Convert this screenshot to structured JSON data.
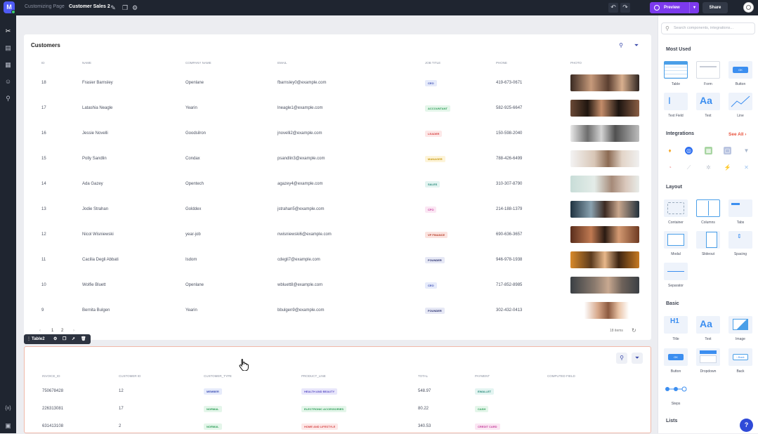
{
  "topbar": {
    "logo": "M",
    "breadcrumb_app": "Customizing Page",
    "page_name": "Customer Sales 2",
    "preview_label": "Preview",
    "share_label": "Share"
  },
  "table1": {
    "title": "Customers",
    "columns": [
      "ID",
      "NAME",
      "COMPANY NAME",
      "EMAIL",
      "JOB TITLE",
      "PHONE",
      "PHOTO"
    ],
    "rows": [
      {
        "id": "18",
        "name": "Frasier Barnsley",
        "company": "Openlane",
        "email": "fbarnsley0@example.com",
        "job": "CEO",
        "phone": "419-673-0671"
      },
      {
        "id": "17",
        "name": "Latashia Neagle",
        "company": "Yearin",
        "email": "lneagle1@example.com",
        "job": "ACCOUNTANT",
        "phone": "582-925-6647"
      },
      {
        "id": "16",
        "name": "Jessie Novelli",
        "company": "Goodsilron",
        "email": "jnovelli2@example.com",
        "job": "LEADER",
        "phone": "150-598-2040"
      },
      {
        "id": "15",
        "name": "Polly Sandlin",
        "company": "Condax",
        "email": "psandlin3@example.com",
        "job": "MANAGER",
        "phone": "788-426-6499"
      },
      {
        "id": "14",
        "name": "Ada Gazey",
        "company": "Opentech",
        "email": "agazey4@example.com",
        "job": "SALES",
        "phone": "310-307-8790"
      },
      {
        "id": "13",
        "name": "Jodie Strahan",
        "company": "Golddex",
        "email": "jstrahan5@example.com",
        "job": "CFO",
        "phone": "214-188-1379"
      },
      {
        "id": "12",
        "name": "Nicol Wisniewski",
        "company": "year-job",
        "email": "nwisniewski6@example.com",
        "job": "VP FINANCE",
        "phone": "690-636-3657"
      },
      {
        "id": "11",
        "name": "Cacilia Degli Abbati",
        "company": "Isdom",
        "email": "cdegli7@example.com",
        "job": "FOUNDER",
        "phone": "946-978-1938"
      },
      {
        "id": "10",
        "name": "Wolfie Bluett",
        "company": "Openlane",
        "email": "wbluett8@example.com",
        "job": "CEO",
        "phone": "717-852-8985"
      },
      {
        "id": "9",
        "name": "Bernita Bulgen",
        "company": "Yearin",
        "email": "bbulgen9@example.com",
        "job": "FOUNDER",
        "phone": "302-432-0413"
      }
    ],
    "pager": {
      "prev": "‹",
      "p1": "1",
      "p2": "2",
      "next": "›"
    },
    "items_count": "18 items"
  },
  "table2": {
    "toolbar_name": "Table2",
    "columns": [
      "INVOICE_ID",
      "CUSTOMER ID",
      "CUSTOMER_TYPE",
      "PRODUCT_LINE",
      "TOTAL",
      "PAYMENT",
      "COMPUTED FIELD"
    ],
    "rows": [
      {
        "invoice": "750678428",
        "cust": "12",
        "type": "MEMBER",
        "product": "HEALTH AND BEAUTY",
        "total": "548.97",
        "payment": "EWALLET"
      },
      {
        "invoice": "226313081",
        "cust": "17",
        "type": "NORMAL",
        "product": "ELECTRONIC ACCESSORIES",
        "total": "80.22",
        "payment": "CASH"
      },
      {
        "invoice": "631413108",
        "cust": "2",
        "type": "NORMAL",
        "product": "HOME AND LIFESTYLE",
        "total": "340.53",
        "payment": "CREDIT CARD"
      }
    ]
  },
  "rightpanel": {
    "search_placeholder": "Search components, integrations...",
    "most_used": "Most Used",
    "most_used_items": [
      "Table",
      "Form",
      "Button",
      "Text Field",
      "Text",
      "Line"
    ],
    "integrations": "Integrations",
    "see_all": "See All",
    "layout": "Layout",
    "layout_items": [
      "Container",
      "Columns",
      "Tabs",
      "Modal",
      "Slideout",
      "Spacing",
      "Separator"
    ],
    "basic": "Basic",
    "basic_items": [
      "Title",
      "Text",
      "Image",
      "Button",
      "Dropdown",
      "Back",
      "Steps"
    ],
    "lists": "Lists"
  },
  "colors": {
    "accent": "#7c3aed",
    "primary": "#3949ab",
    "dark": "#1f2530"
  }
}
